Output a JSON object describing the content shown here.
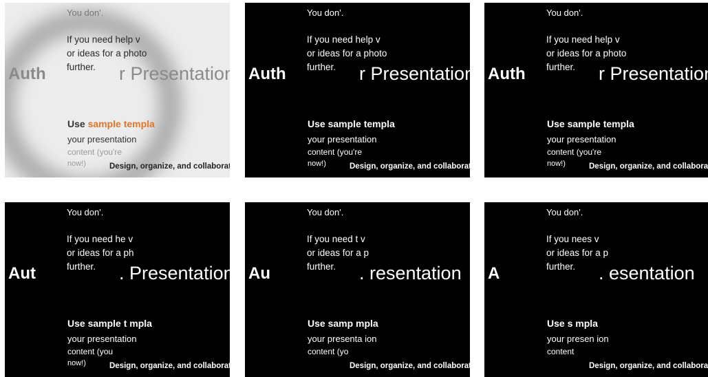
{
  "colors": {
    "dark_bg": "#000000",
    "light_bg": "#ececec",
    "accent": "#e0752a"
  },
  "panels": [
    {
      "theme": "light",
      "you": "You don'.",
      "help": "If you need help v\nor ideas for a photo\nfurther.",
      "title_left": "Auth",
      "title_right": "r Presentation",
      "use_prefix": "Use ",
      "use_accent": "sample templa",
      "your": "your presentation",
      "content": "content (you're",
      "now": "now!)",
      "design": "Design, organize, and collaborate"
    },
    {
      "theme": "dark",
      "you": "You don'.",
      "help": "If you need help v\nor ideas for a photo\nfurther.",
      "title_left": "Auth",
      "title_right": "r Presentation",
      "use_prefix": "Use ",
      "use_accent": "sample templa",
      "your": "your presentation",
      "content": "content (you're",
      "now": "now!)",
      "design": "Design, organize, and collaborate"
    },
    {
      "theme": "dark",
      "you": "You don'.",
      "help": "If you need help v\nor ideas for a photo\nfurther.",
      "title_left": "Auth",
      "title_right": "r Presentation",
      "use_prefix": "Use ",
      "use_accent": "sample templa",
      "your": "your presentation",
      "content": "content (you're",
      "now": "now!)",
      "design": "Design, organize, and collaborate"
    },
    {
      "theme": "dark",
      "you": "You don'.",
      "help": "If you need he v\nor ideas for a ph\nfurther.",
      "title_left": "Aut",
      "title_right": ". Presentation",
      "use_prefix": "Use ",
      "use_accent": "sample t mpla",
      "your": "your presentation",
      "content": "content (you",
      "now": "now!)",
      "design": "Design, organize, and collaborate"
    },
    {
      "theme": "dark",
      "you": "You don'.",
      "help": "If you need t v\nor ideas for a p\nfurther.",
      "title_left": "Au",
      "title_right": ". resentation",
      "use_prefix": "Use ",
      "use_accent": "samp mpla",
      "your": "your presenta ion",
      "content": "content (yo",
      "now": "",
      "design": "Design, organize, and collaborate"
    },
    {
      "theme": "dark",
      "you": "You don'.",
      "help": "If you nees v\nor ideas for a p\nfurther.",
      "title_left": "A",
      "title_right": ". esentation",
      "use_prefix": "Use ",
      "use_accent": "s mpla",
      "your": "your presen ion",
      "content": "content",
      "now": "",
      "design": "Design, organize, and collaborate"
    }
  ]
}
